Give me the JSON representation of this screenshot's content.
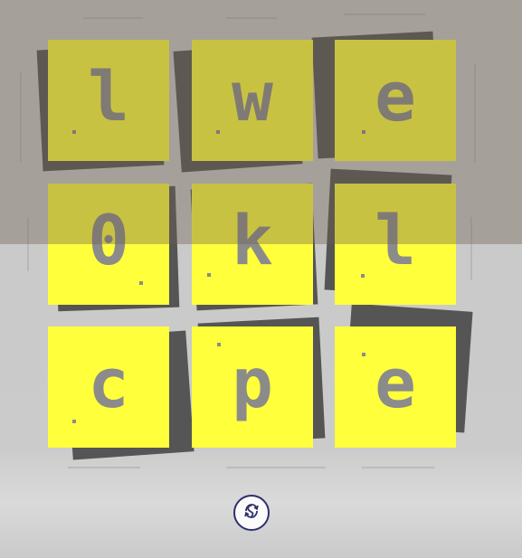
{
  "board": {
    "tile_color": "#ffff3c",
    "letter_color": "#8b8b8b",
    "shadow_color": "#555555",
    "overlay_color": "rgba(110,95,80,0.38)",
    "tiles": [
      {
        "letter": "l"
      },
      {
        "letter": "w"
      },
      {
        "letter": "e"
      },
      {
        "letter": "0"
      },
      {
        "letter": "k"
      },
      {
        "letter": "l"
      },
      {
        "letter": "c"
      },
      {
        "letter": "p"
      },
      {
        "letter": "e"
      }
    ]
  },
  "controls": {
    "shuffle_icon": "shuffle-icon"
  }
}
